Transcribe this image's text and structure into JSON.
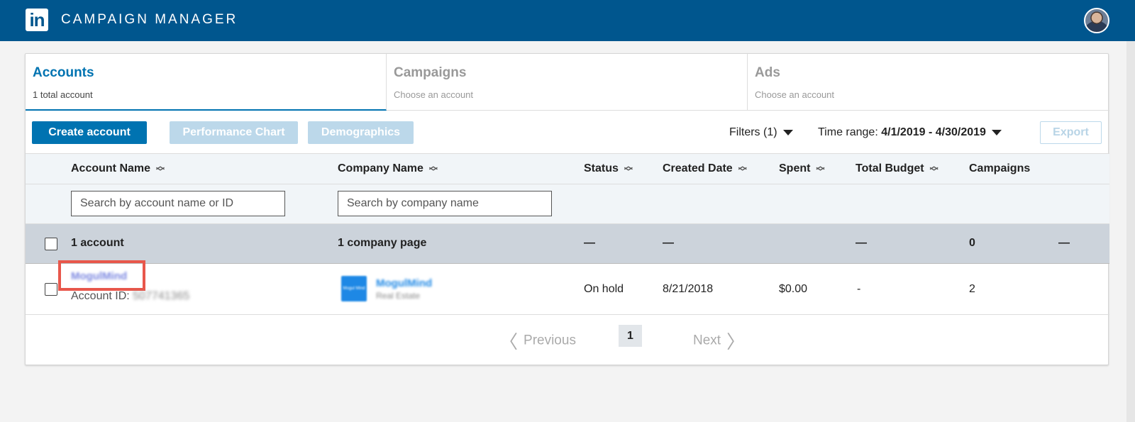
{
  "header": {
    "logo_text": "in",
    "app_title": "CAMPAIGN MANAGER"
  },
  "tabs": [
    {
      "title": "Accounts",
      "subtitle": "1 total account"
    },
    {
      "title": "Campaigns",
      "subtitle": "Choose an account"
    },
    {
      "title": "Ads",
      "subtitle": "Choose an account"
    }
  ],
  "toolbar": {
    "create_account": "Create account",
    "performance_chart": "Performance Chart",
    "demographics": "Demographics",
    "filters": "Filters (1)",
    "time_range_label": "Time range:",
    "time_range_value": "4/1/2019 - 4/30/2019",
    "export": "Export"
  },
  "table": {
    "columns": [
      "Account Name",
      "Company Name",
      "Status",
      "Created Date",
      "Spent",
      "Total Budget",
      "Campaigns"
    ],
    "search": {
      "account_placeholder": "Search by account name or ID",
      "company_placeholder": "Search by company name"
    },
    "summary": {
      "accounts": "1 account",
      "companies": "1 company page",
      "status": "—",
      "created": "—",
      "budget": "—",
      "campaigns": "0",
      "trailing": "—"
    },
    "rows": [
      {
        "account_name": "MogulMind",
        "account_id_label": "Account ID:",
        "account_id": "507741365",
        "company_name": "MogulMind",
        "company_type": "Real Estate",
        "company_logo_text": "Mogul Mind",
        "status": "On hold",
        "created": "8/21/2018",
        "spent": "$0.00",
        "budget": "-",
        "campaigns": "2"
      }
    ]
  },
  "pagination": {
    "previous": "Previous",
    "page": "1",
    "next": "Next"
  },
  "colors": {
    "header_bg": "#00568e",
    "primary": "#0073b1",
    "highlight": "#e8574b"
  }
}
